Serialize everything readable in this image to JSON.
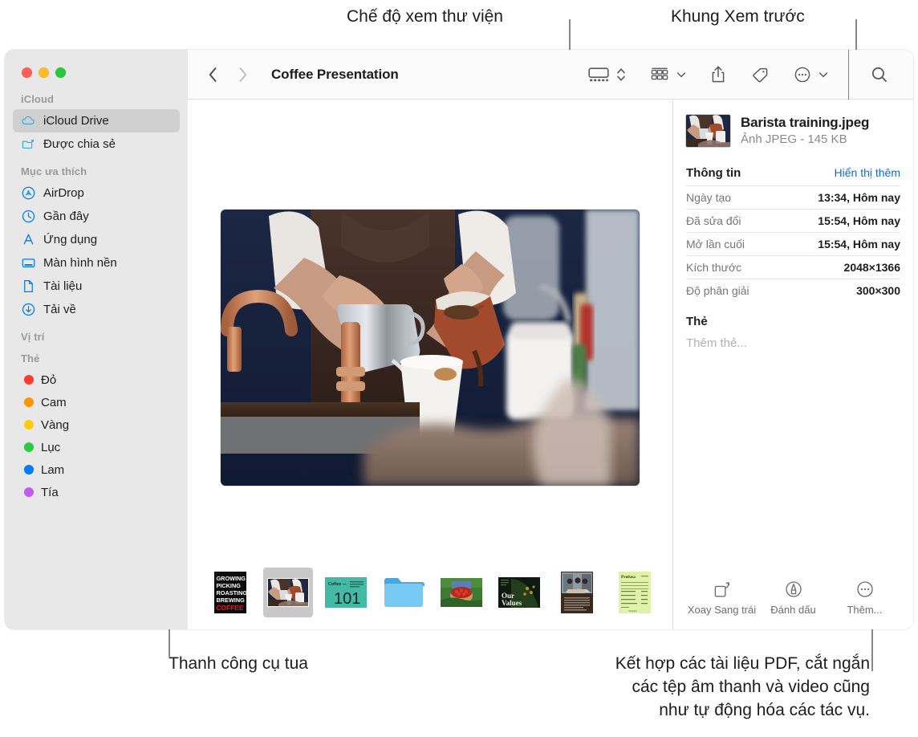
{
  "callouts": {
    "top_left": "Chế độ xem thư viện",
    "top_right": "Khung Xem trước",
    "bottom_left": "Thanh công cụ tua",
    "bottom_right": "Kết hợp các tài liệu PDF, cắt ngắn\ncác tệp âm thanh và video cũng\nnhư tự động hóa các tác vụ."
  },
  "window": {
    "title": "Coffee Presentation"
  },
  "sidebar": {
    "sections": [
      {
        "label": "iCloud"
      },
      {
        "label": "Mục ưa thích"
      },
      {
        "label": "Vị trí"
      },
      {
        "label": "Thẻ"
      }
    ],
    "icloud_items": [
      {
        "label": "iCloud Drive",
        "icon": "cloud-icon",
        "selected": true
      },
      {
        "label": "Được chia sẻ",
        "icon": "shared-folder-icon",
        "selected": false
      }
    ],
    "favorite_items": [
      {
        "label": "AirDrop",
        "icon": "airdrop-icon"
      },
      {
        "label": "Gần đây",
        "icon": "clock-icon"
      },
      {
        "label": "Ứng dụng",
        "icon": "applications-icon"
      },
      {
        "label": "Màn hình nền",
        "icon": "desktop-icon"
      },
      {
        "label": "Tài liệu",
        "icon": "document-icon"
      },
      {
        "label": "Tải về",
        "icon": "downloads-icon"
      }
    ],
    "tags": [
      {
        "label": "Đỏ",
        "color": "#ff3b30"
      },
      {
        "label": "Cam",
        "color": "#ff9500"
      },
      {
        "label": "Vàng",
        "color": "#ffcc00"
      },
      {
        "label": "Lục",
        "color": "#28cd41"
      },
      {
        "label": "Lam",
        "color": "#007aff"
      },
      {
        "label": "Tía",
        "color": "#bf5af2"
      }
    ]
  },
  "toolbar": {
    "back_label": "Quay lại",
    "forward_label": "Tiến tới",
    "view_gallery_label": "Chế độ xem thư viện",
    "view_stepper_label": "Đổi chế độ xem",
    "group_label": "Nhóm",
    "share_label": "Chia sẻ",
    "tag_label": "Thẻ",
    "more_label": "Thêm tác vụ",
    "search_label": "Tìm kiếm"
  },
  "inspector": {
    "file_name": "Barista training.jpeg",
    "file_meta": "Ảnh JPEG - 145 KB",
    "info_heading": "Thông tin",
    "show_more_link": "Hiển thị thêm",
    "info_rows": [
      {
        "key": "Ngày tạo",
        "value": "13:34, Hôm nay"
      },
      {
        "key": "Đã sửa đổi",
        "value": "15:54, Hôm nay"
      },
      {
        "key": "Mở lần cuối",
        "value": "15:54, Hôm nay"
      },
      {
        "key": "Kích thước",
        "value": "2048×1366"
      },
      {
        "key": "Độ phân giải",
        "value": "300×300"
      }
    ],
    "tags_heading": "Thẻ",
    "tags_placeholder": "Thêm thẻ...",
    "actions": [
      {
        "label": "Xoay Sang trái",
        "icon": "rotate-left-icon"
      },
      {
        "label": "Đánh dấu",
        "icon": "markup-icon"
      },
      {
        "label": "Thêm...",
        "icon": "more-circle-icon"
      }
    ]
  },
  "thumbnails": [
    {
      "name": "coffee-poster",
      "type": "poster",
      "lines": [
        "GROWING",
        "PICKING",
        "ROASTING",
        "BREWING",
        "COFFEE"
      ],
      "selected": false
    },
    {
      "name": "barista-training",
      "type": "photo-barista",
      "selected": true
    },
    {
      "name": "coffee-101",
      "type": "slide-101",
      "title": "Coffee —",
      "big": "101",
      "selected": false
    },
    {
      "name": "folder",
      "type": "folder",
      "selected": false
    },
    {
      "name": "berries-basket",
      "type": "photo-berries",
      "selected": false
    },
    {
      "name": "our-values",
      "type": "slide-values",
      "line1": "Our",
      "line2": "Values",
      "selected": false
    },
    {
      "name": "meeting-doc",
      "type": "doc-meeting",
      "selected": false
    },
    {
      "name": "invoice",
      "type": "doc-invoice",
      "title": "Profusa",
      "selected": false
    }
  ],
  "colors": {
    "accent_blue": "#0a6fe8",
    "sidebar_bg": "#e8e8e8",
    "selected_row": "#cfcfcf",
    "toolbar_bg": "#fbfbfb",
    "text_primary": "#1d1d1f",
    "text_secondary": "#8a8a8e"
  }
}
